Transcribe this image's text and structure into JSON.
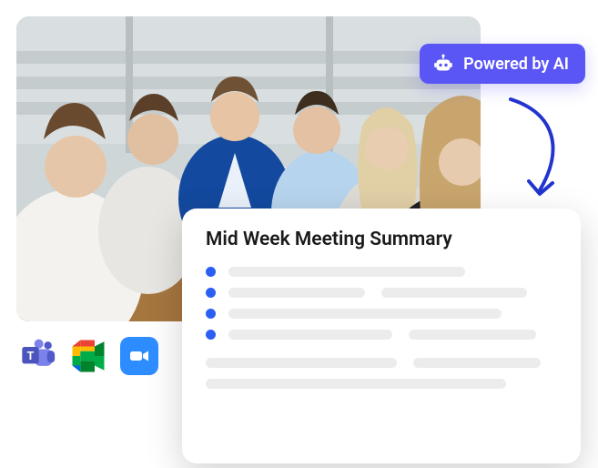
{
  "badge": {
    "label": "Powered by AI",
    "icon_name": "robot-icon"
  },
  "card": {
    "title": "Mid Week Meeting Summary"
  },
  "apps": [
    {
      "name": "microsoft-teams-icon"
    },
    {
      "name": "google-meet-icon"
    },
    {
      "name": "zoom-icon"
    }
  ],
  "colors": {
    "accent": "#5a55f5",
    "bullet": "#2b5ff4",
    "zoom": "#2d8cff"
  }
}
